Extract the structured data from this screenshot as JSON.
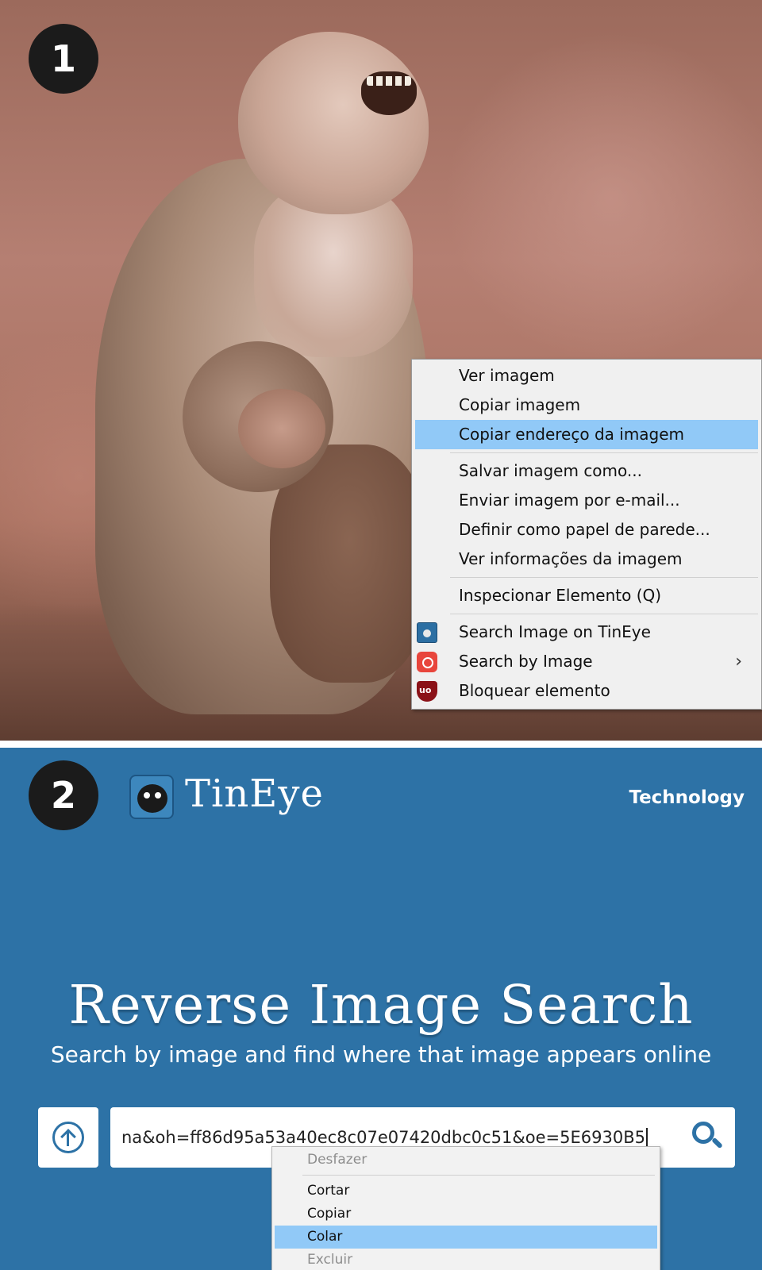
{
  "panel1": {
    "step_number": "1",
    "context_menu": {
      "items": [
        {
          "label": "Ver imagem"
        },
        {
          "label": "Copiar imagem"
        },
        {
          "label": "Copiar endereço da imagem"
        },
        {
          "label": "Salvar imagem como..."
        },
        {
          "label": "Enviar imagem por e-mail..."
        },
        {
          "label": "Definir como papel de parede..."
        },
        {
          "label": "Ver informações da imagem"
        },
        {
          "label": "Inspecionar Elemento (Q)"
        },
        {
          "label": "Search Image on TinEye",
          "icon": "tineye-icon"
        },
        {
          "label": "Search by Image",
          "icon": "camera-icon",
          "submenu_arrow": "›"
        },
        {
          "label": "Bloquear elemento",
          "icon": "ublock-icon"
        }
      ],
      "highlighted_index": 2,
      "highlight_color": "#91c9f7"
    }
  },
  "panel2": {
    "step_number": "2",
    "brand": "TinEye",
    "nav_link": "Technology",
    "hero_title": "Reverse Image Search",
    "hero_subtitle": "Search by image and find where that image appears online",
    "search_input_value": "na&oh=ff86d95a53a40ec8c07e07420dbc0c51&oe=5E6930B5",
    "background_color": "#2d72a6",
    "edit_menu": {
      "items": [
        {
          "label": "Desfazer",
          "disabled": true
        },
        {
          "label": "Cortar",
          "disabled": false
        },
        {
          "label": "Copiar",
          "disabled": false
        },
        {
          "label": "Colar",
          "disabled": false
        },
        {
          "label": "Excluir",
          "disabled": true
        }
      ],
      "highlighted_index": 3
    }
  }
}
